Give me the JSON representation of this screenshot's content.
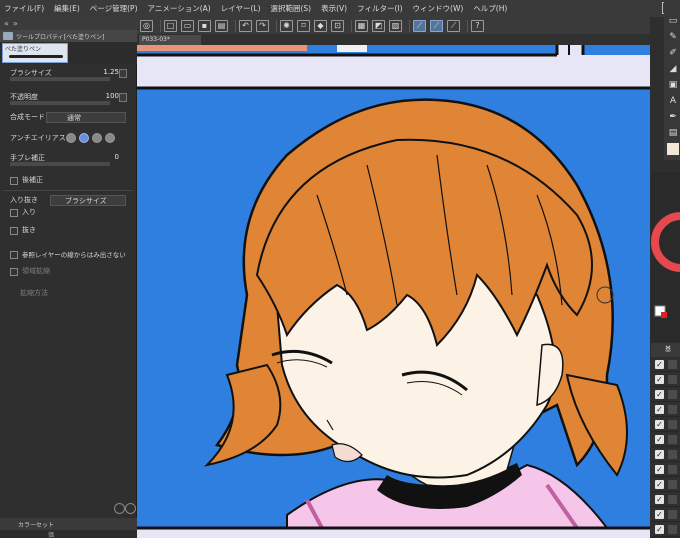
{
  "menubar": {
    "items": [
      "ファイル(F)",
      "編集(E)",
      "ページ管理(P)",
      "アニメーション(A)",
      "レイヤー(L)",
      "選択範囲(S)",
      "表示(V)",
      "フィルター(I)",
      "ウィンドウ(W)",
      "ヘルプ(H)"
    ]
  },
  "tool_panel": {
    "tab_label": "ツールプロパティ[べた塗りペン]",
    "preset_label": "べた塗りペン",
    "brush_size": {
      "label": "ブラシサイズ",
      "value": "1.25"
    },
    "opacity": {
      "label": "不透明度",
      "value": "100"
    },
    "blend_mode": {
      "label": "合成モード",
      "value": "通常"
    },
    "antialias": {
      "label": "アンチエイリアス"
    },
    "stabilization": {
      "label": "手ブレ補正",
      "value": "0"
    },
    "post_correction": {
      "label": "後補正"
    },
    "taper": {
      "label": "入り抜き",
      "value": "ブラシサイズ"
    },
    "taper_in": {
      "label": "入り"
    },
    "taper_out": {
      "label": "抜き"
    },
    "ref_layer": {
      "label": "参照レイヤーの線からはみ出さない"
    },
    "area_scale": {
      "label": "領域拡縮"
    },
    "scale_method": {
      "label": "拡縮方法"
    }
  },
  "palette": {
    "tabs": [
      "カラーセット"
    ],
    "footer": "価"
  },
  "document": {
    "tab_title": "P033-03*"
  },
  "layers": {
    "tab_label": "基"
  },
  "colors": {
    "hair": "#e08535",
    "sky": "#2f7fe0",
    "skin": "#fcf3e6",
    "shirt": "#f6c6ea",
    "panel_bg": "#e6e6f6"
  }
}
